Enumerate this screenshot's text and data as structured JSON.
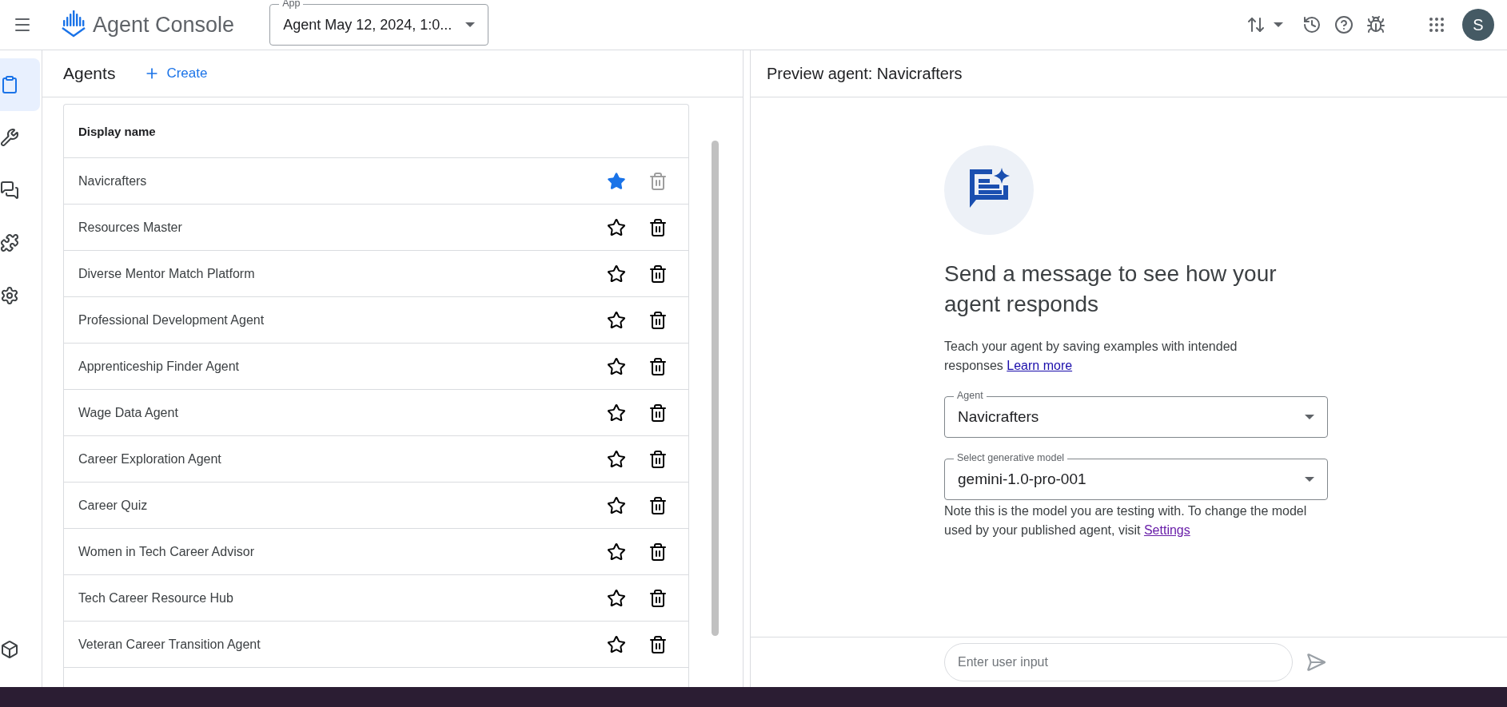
{
  "app_bar": {
    "title": "Agent Console",
    "app_select": {
      "label": "App",
      "value": "Agent May 12, 2024, 1:0..."
    },
    "avatar": "S"
  },
  "sidebar": {
    "items": [
      {
        "selected": true
      },
      {
        "selected": false
      },
      {
        "selected": false
      },
      {
        "selected": false
      },
      {
        "selected": false
      }
    ]
  },
  "agents_panel": {
    "title": "Agents",
    "create_label": "Create",
    "table": {
      "columns": [
        "Display name"
      ],
      "rows": [
        {
          "name": "Navicrafters",
          "starred": true,
          "delete_disabled": true
        },
        {
          "name": "Resources Master",
          "starred": false,
          "delete_disabled": false
        },
        {
          "name": "Diverse Mentor Match Platform",
          "starred": false,
          "delete_disabled": false
        },
        {
          "name": "Professional Development Agent",
          "starred": false,
          "delete_disabled": false
        },
        {
          "name": "Apprenticeship Finder Agent",
          "starred": false,
          "delete_disabled": false
        },
        {
          "name": "Wage Data Agent",
          "starred": false,
          "delete_disabled": false
        },
        {
          "name": "Career Exploration Agent",
          "starred": false,
          "delete_disabled": false
        },
        {
          "name": "Career Quiz",
          "starred": false,
          "delete_disabled": false
        },
        {
          "name": "Women in Tech Career Advisor",
          "starred": false,
          "delete_disabled": false
        },
        {
          "name": "Tech Career Resource Hub",
          "starred": false,
          "delete_disabled": false
        },
        {
          "name": "Veteran Career Transition Agent",
          "starred": false,
          "delete_disabled": false
        }
      ]
    }
  },
  "preview_panel": {
    "title": "Preview agent: Navicrafters",
    "heading": "Send a message to see how your agent responds",
    "intro": "Teach your agent by saving examples with intended responses",
    "intro_link": "Learn more",
    "agent_select": {
      "label": "Agent",
      "value": "Navicrafters"
    },
    "model_select": {
      "label": "Select generative model",
      "value": "gemini-1.0-pro-001"
    },
    "note": "Note this is the model you are testing with. To change the model used by your published agent, visit",
    "note_link": "Settings",
    "input": {
      "placeholder": "Enter user input"
    }
  }
}
